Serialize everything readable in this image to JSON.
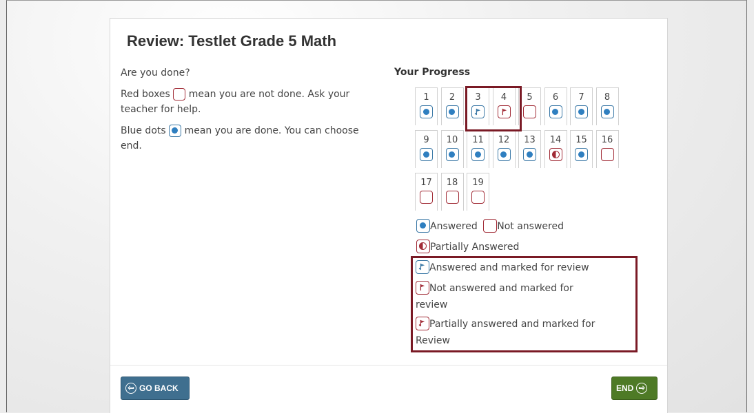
{
  "title": "Review: Testlet Grade 5 Math",
  "left": {
    "question": "Are you done?",
    "red_text_a": "Red boxes",
    "red_text_b": "mean you are not done. Ask your teacher for help.",
    "blue_text_a": "Blue dots",
    "blue_text_b": "mean you are done. You can choose end."
  },
  "progress_heading": "Your Progress",
  "items": [
    {
      "num": "1",
      "status": "answered"
    },
    {
      "num": "2",
      "status": "answered"
    },
    {
      "num": "3",
      "status": "answered-marked"
    },
    {
      "num": "4",
      "status": "not-answered-marked"
    },
    {
      "num": "5",
      "status": "not-answered"
    },
    {
      "num": "6",
      "status": "answered"
    },
    {
      "num": "7",
      "status": "answered"
    },
    {
      "num": "8",
      "status": "answered"
    },
    {
      "num": "9",
      "status": "answered"
    },
    {
      "num": "10",
      "status": "answered"
    },
    {
      "num": "11",
      "status": "answered"
    },
    {
      "num": "12",
      "status": "answered"
    },
    {
      "num": "13",
      "status": "answered"
    },
    {
      "num": "14",
      "status": "partial"
    },
    {
      "num": "15",
      "status": "answered"
    },
    {
      "num": "16",
      "status": "not-answered"
    },
    {
      "num": "17",
      "status": "not-answered"
    },
    {
      "num": "18",
      "status": "not-answered"
    },
    {
      "num": "19",
      "status": "not-answered"
    }
  ],
  "legend": {
    "answered": "Answered",
    "not_answered": "Not answered",
    "partial": "Partially Answered",
    "answered_marked": "Answered and marked for review",
    "not_answered_marked_a": "Not answered and marked for",
    "not_answered_marked_b": "review",
    "partial_marked_a": "Partially answered and marked for",
    "partial_marked_b": "Review"
  },
  "buttons": {
    "back": "GO BACK",
    "end": "END"
  },
  "colors": {
    "answered": "#2f7fc0",
    "not_answered": "#a12b36",
    "highlight": "#7a1a25",
    "back_button": "#3f6f8f",
    "end_button": "#4e7a26"
  }
}
